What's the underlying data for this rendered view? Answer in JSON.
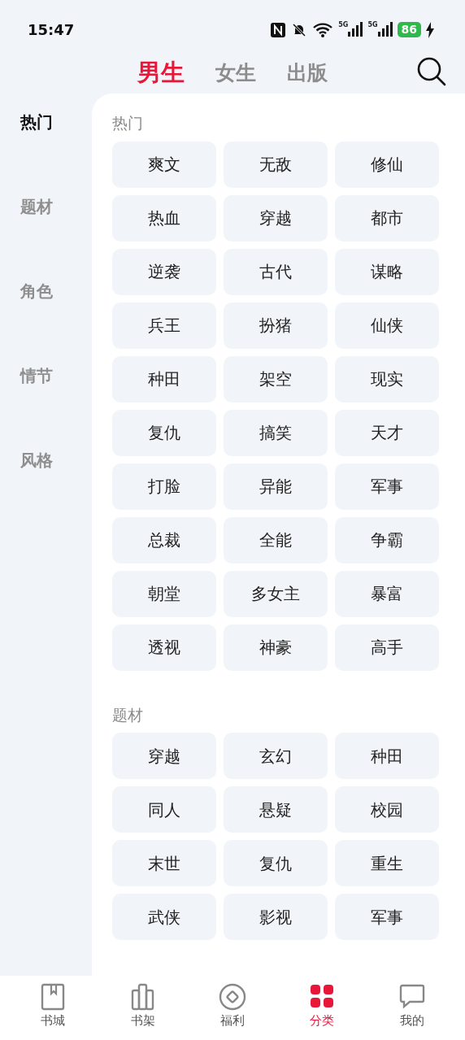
{
  "status_bar": {
    "time": "15:47",
    "network_labels": [
      "5G",
      "5G"
    ],
    "battery": "86"
  },
  "tabs": [
    {
      "label": "男生",
      "selected": true
    },
    {
      "label": "女生",
      "selected": false
    },
    {
      "label": "出版",
      "selected": false
    }
  ],
  "sidebar": {
    "items": [
      {
        "label": "热门",
        "selected": true
      },
      {
        "label": "题材",
        "selected": false
      },
      {
        "label": "角色",
        "selected": false
      },
      {
        "label": "情节",
        "selected": false
      },
      {
        "label": "风格",
        "selected": false
      }
    ]
  },
  "sections": [
    {
      "title": "热门",
      "tags": [
        "爽文",
        "无敌",
        "修仙",
        "热血",
        "穿越",
        "都市",
        "逆袭",
        "古代",
        "谋略",
        "兵王",
        "扮猪",
        "仙侠",
        "种田",
        "架空",
        "现实",
        "复仇",
        "搞笑",
        "天才",
        "打脸",
        "异能",
        "军事",
        "总裁",
        "全能",
        "争霸",
        "朝堂",
        "多女主",
        "暴富",
        "透视",
        "神豪",
        "高手"
      ]
    },
    {
      "title": "题材",
      "tags": [
        "穿越",
        "玄幻",
        "种田",
        "同人",
        "悬疑",
        "校园",
        "末世",
        "复仇",
        "重生",
        "武侠",
        "影视",
        "军事"
      ]
    }
  ],
  "bottom_nav": [
    {
      "label": "书城",
      "selected": false
    },
    {
      "label": "书架",
      "selected": false
    },
    {
      "label": "福利",
      "selected": false
    },
    {
      "label": "分类",
      "selected": true
    },
    {
      "label": "我的",
      "selected": false
    }
  ]
}
